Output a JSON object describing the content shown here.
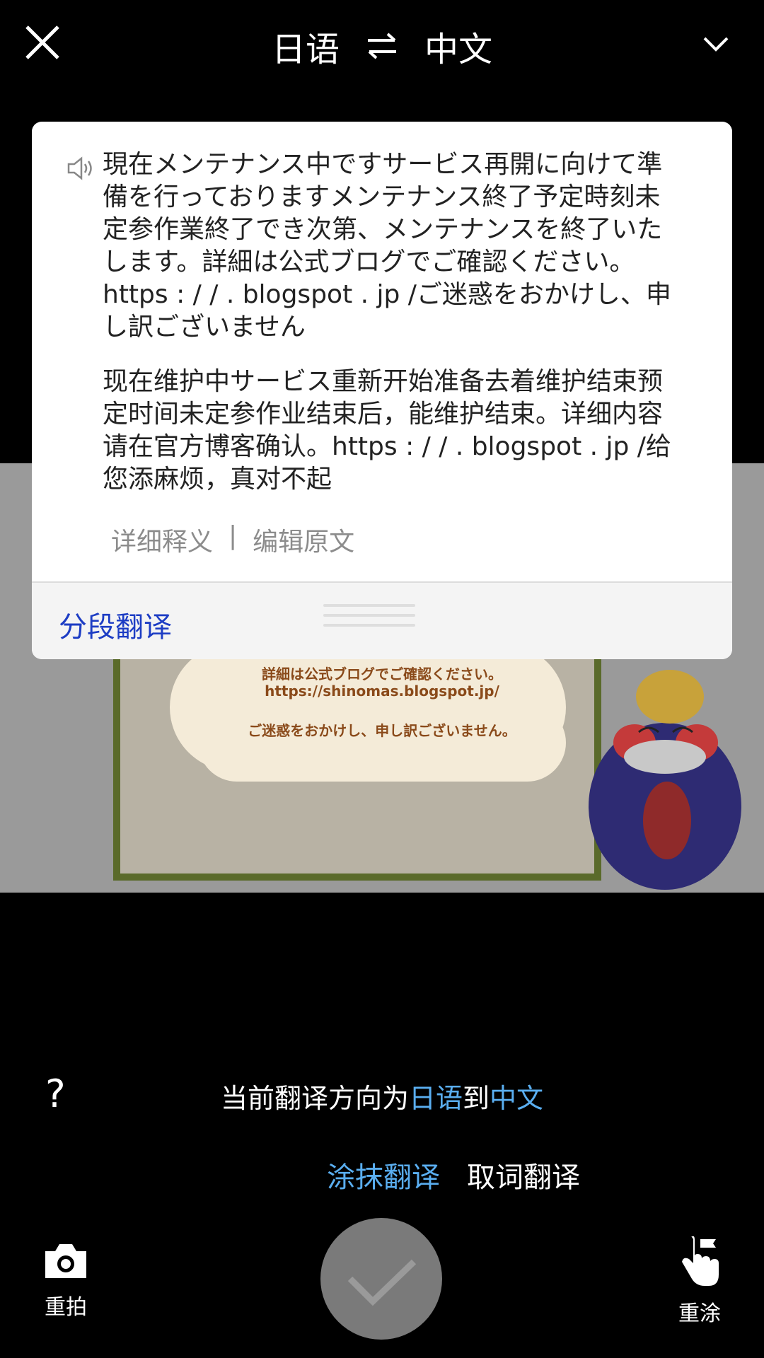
{
  "header": {
    "source_lang": "日语",
    "target_lang": "中文",
    "close_icon": "close-icon",
    "swap_icon": "swap-arrows-icon",
    "expand_icon": "chevron-down-icon"
  },
  "photo": {
    "line1": "詳細は公式ブログでご確認ください。",
    "line2": "https://shinomas.blogspot.jp/",
    "line3": "ご迷惑をおかけし、申し訳ございません。"
  },
  "card": {
    "original_text": "現在メンテナンス中ですサービス再開に向けて準備を行っておりますメンテナンス終了予定時刻未定参作業終了でき次第、メンテナンスを終了いたします。詳細は公式ブログでご確認ください。 https : / / . blogspot . jp /ご迷惑をおかけし、申し訳ございません",
    "translated_text": "现在维护中サービス重新开始准备去着维护结束预定时间未定参作业结束后，能维护结束。详细内容请在官方博客确认。https : / / . blogspot . jp /给您添麻烦，真对不起",
    "detail_link": "详细释义",
    "separator": "|",
    "edit_link": "编辑原文",
    "segment_label": "分段翻译"
  },
  "bottom": {
    "help": "?",
    "direction_prefix": "当前翻译方向为",
    "direction_from": "日语",
    "direction_mid": "到",
    "direction_to": "中文",
    "mode_smear": "涂抹翻译",
    "mode_pick": "取词翻译",
    "retake_label": "重拍",
    "redo_label": "重涂"
  },
  "colors": {
    "accent_blue": "#5aaef0",
    "link_blue": "#1d3dc4",
    "background": "#000000"
  }
}
